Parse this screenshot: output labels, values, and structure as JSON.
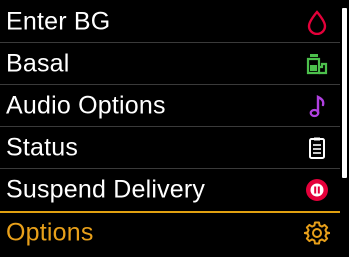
{
  "menu": {
    "items": [
      {
        "label": "Enter BG",
        "icon": "blood-drop-icon",
        "icon_color": "#e4003a"
      },
      {
        "label": "Basal",
        "icon": "basal-profile-icon",
        "icon_color": "#4cc04c"
      },
      {
        "label": "Audio Options",
        "icon": "music-note-icon",
        "icon_color": "#b040e0"
      },
      {
        "label": "Status",
        "icon": "clipboard-icon",
        "icon_color": "#ffffff"
      },
      {
        "label": "Suspend Delivery",
        "icon": "pause-circle-icon",
        "icon_color": "#e4003a"
      },
      {
        "label": "Options",
        "icon": "gear-icon",
        "icon_color": "#e8a01a"
      }
    ],
    "selected_index": 5
  },
  "colors": {
    "background": "#000000",
    "text": "#ffffff",
    "selected_text": "#e8a01a",
    "selection_border": "#e0a010"
  }
}
